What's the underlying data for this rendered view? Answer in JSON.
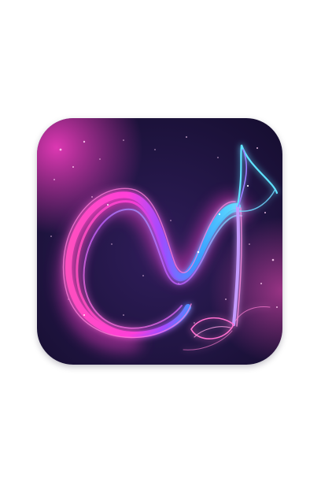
{
  "icon": {
    "name": "music-note-logo-icon",
    "colors": {
      "background_dark": "#1c1238",
      "background_mid": "#2a1a52",
      "magenta": "#ff2fd0",
      "pink": "#ff5fb8",
      "violet": "#a046ff",
      "cyan": "#3fd6ff",
      "blue": "#3a7bff",
      "sparkle": "#ffd0f4"
    }
  }
}
